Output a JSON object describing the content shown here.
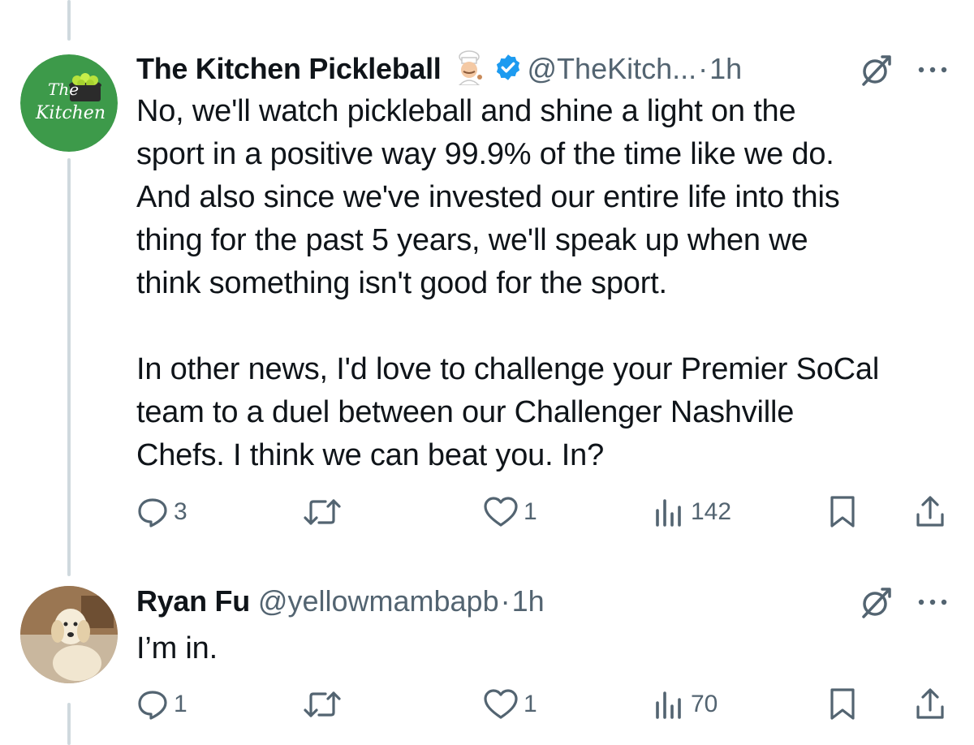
{
  "colors": {
    "text": "#0f1419",
    "secondary": "#536471",
    "verified": "#1d9bf0",
    "thread_line": "#cfd9de",
    "kitchen_green": "#3d9a4a"
  },
  "tweets": [
    {
      "display_name": "The Kitchen Pickleball",
      "name_emoji": "chef-emoji",
      "verified": true,
      "handle": "@TheKitch...",
      "separator": "·",
      "time": "1h",
      "avatar_lines": [
        "The",
        "Kitchen"
      ],
      "text": "No, we'll watch pickleball and shine a light on the\nsport in a positive way 99.9% of the time like we do.\nAnd also since we've invested our entire life into this\nthing for the past 5 years, we'll speak up when we\nthink something isn't good for the sport.\n\nIn other news, I'd love to challenge your Premier SoCal\nteam to a duel between our Challenger Nashville\nChefs. I think we can beat you. In?",
      "actions": {
        "replies": "3",
        "reposts": "",
        "likes": "1",
        "views": "142"
      }
    },
    {
      "display_name": "Ryan Fu",
      "handle": "@yellowmambapb",
      "separator": "·",
      "time": "1h",
      "avatar": "dog-photo",
      "text": "I’m in.",
      "actions": {
        "replies": "1",
        "reposts": "",
        "likes": "1",
        "views": "70"
      }
    }
  ],
  "icons": [
    "grok-icon",
    "more-icon",
    "reply-icon",
    "repost-icon",
    "like-icon",
    "views-icon",
    "bookmark-icon",
    "share-icon"
  ]
}
